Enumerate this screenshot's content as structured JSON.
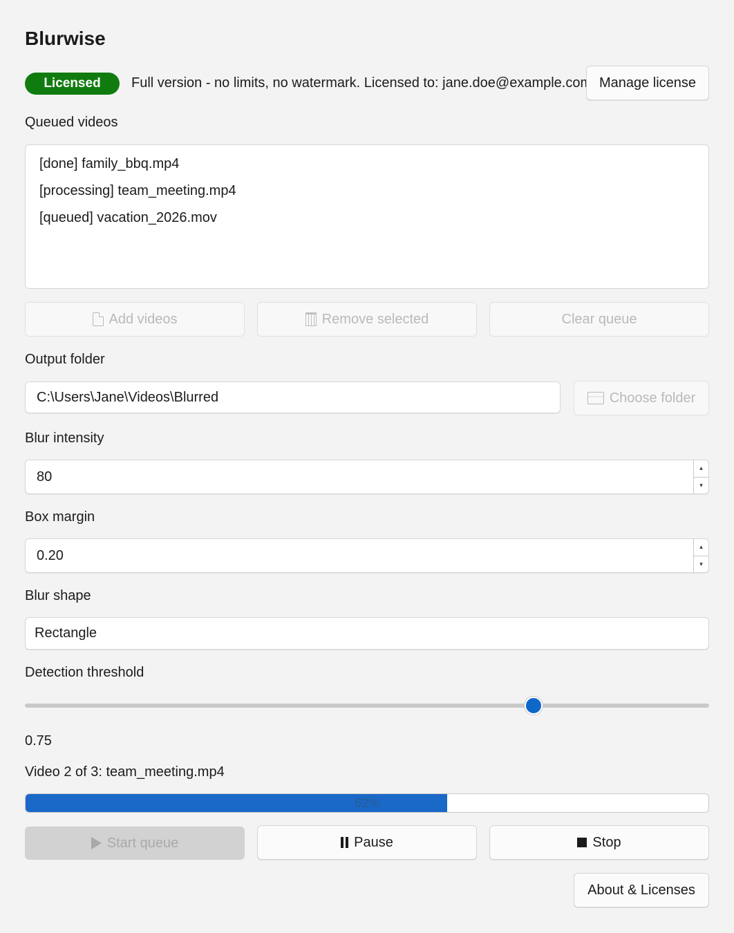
{
  "app": {
    "title": "Blurwise"
  },
  "license": {
    "badge": "Licensed",
    "text": "Full version - no limits, no watermark. Licensed to: jane.doe@example.com",
    "manage_label": "Manage license",
    "badge_color": "#107c10"
  },
  "queue": {
    "label": "Queued videos",
    "items": [
      "[done] family_bbq.mp4",
      "[processing] team_meeting.mp4",
      "[queued] vacation_2026.mov"
    ],
    "add_label": "Add videos",
    "remove_label": "Remove selected",
    "clear_label": "Clear queue",
    "add_icon": "file-icon",
    "remove_icon": "trash-icon"
  },
  "output": {
    "label": "Output folder",
    "value": "C:\\Users\\Jane\\Videos\\Blurred",
    "choose_label": "Choose folder",
    "choose_icon": "folder-icon"
  },
  "blur_intensity": {
    "label": "Blur intensity",
    "value": "80"
  },
  "box_margin": {
    "label": "Box margin",
    "value": "0.20"
  },
  "blur_shape": {
    "label": "Blur shape",
    "value": "Rectangle"
  },
  "detection": {
    "label": "Detection threshold",
    "value": "0.75",
    "slider_fraction": 0.743
  },
  "progress": {
    "status": "Video 2 of 3: team_meeting.mp4",
    "percent_label": "62%",
    "fraction": 0.617,
    "fill_color": "#1a68c7"
  },
  "controls": {
    "start_label": "Start queue",
    "pause_label": "Pause",
    "stop_label": "Stop"
  },
  "footer": {
    "about_label": "About & Licenses"
  },
  "accent_color": "#0f68c9"
}
